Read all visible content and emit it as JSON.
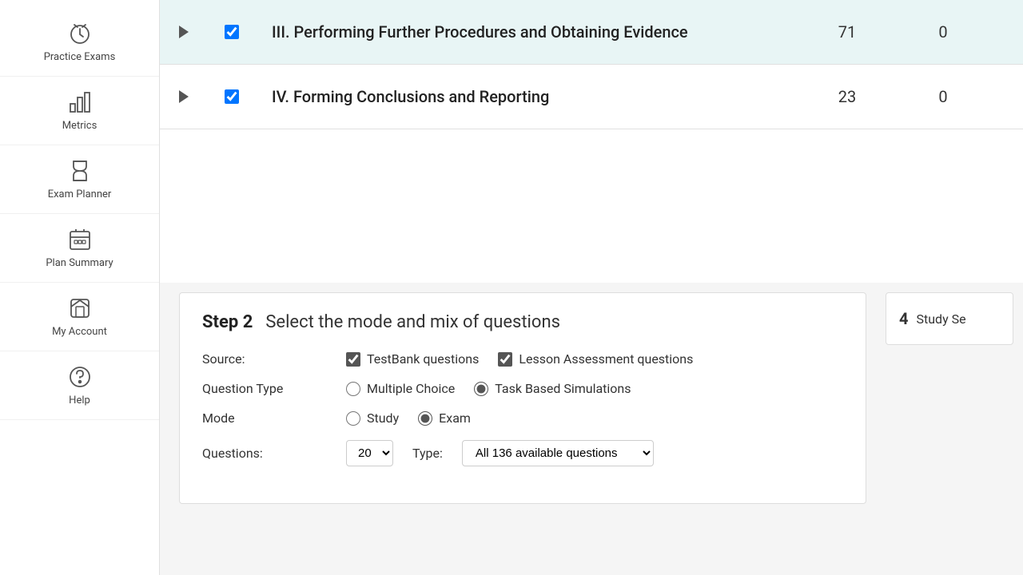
{
  "sidebar": {
    "items": [
      {
        "id": "practice-exams",
        "label": "Practice Exams",
        "icon": "clock-check"
      },
      {
        "id": "metrics",
        "label": "Metrics",
        "icon": "bar-chart"
      },
      {
        "id": "exam-planner",
        "label": "Exam Planner",
        "icon": "hourglass"
      },
      {
        "id": "plan-summary",
        "label": "Plan Summary",
        "icon": "calendar-grid"
      },
      {
        "id": "my-account",
        "label": "My Account",
        "icon": "home-square"
      },
      {
        "id": "help",
        "label": "Help",
        "icon": "question-circle"
      }
    ]
  },
  "table": {
    "rows": [
      {
        "id": "row-iii",
        "title": "III. Performing Further Procedures and Obtaining Evidence",
        "count1": "71",
        "count2": "0",
        "checked": true,
        "expanded": false,
        "teal": true
      },
      {
        "id": "row-iv",
        "title": "IV. Forming Conclusions and Reporting",
        "count1": "23",
        "count2": "0",
        "checked": true,
        "expanded": false,
        "teal": false
      }
    ]
  },
  "step2": {
    "heading_number": "Step 2",
    "heading_title": "Select the mode and mix of questions",
    "source_label": "Source:",
    "source_options": [
      {
        "id": "testbank",
        "label": "TestBank questions",
        "checked": true
      },
      {
        "id": "lesson",
        "label": "Lesson Assessment questions",
        "checked": true
      }
    ],
    "question_type_label": "Question Type",
    "question_type_options": [
      {
        "id": "multiple-choice",
        "label": "Multiple Choice",
        "checked": false
      },
      {
        "id": "task-based",
        "label": "Task Based Simulations",
        "checked": true
      }
    ],
    "mode_label": "Mode",
    "mode_options": [
      {
        "id": "study",
        "label": "Study",
        "checked": false
      },
      {
        "id": "exam",
        "label": "Exam",
        "checked": true
      }
    ],
    "questions_label": "Questions:",
    "questions_value": "20",
    "type_label": "Type:",
    "type_value": "All 136 available questions"
  },
  "step3": {
    "heading_number": "4",
    "heading_title": "Study Se"
  }
}
